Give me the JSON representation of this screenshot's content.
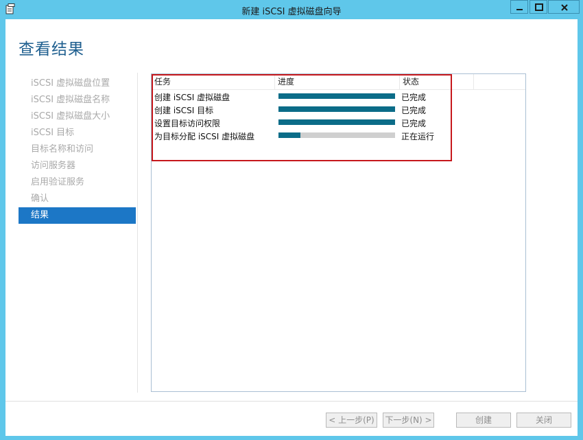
{
  "window": {
    "title": "新建 iSCSI 虚拟磁盘向导"
  },
  "page": {
    "title": "查看结果"
  },
  "sidebar": {
    "steps": [
      {
        "label": "iSCSI 虚拟磁盘位置",
        "active": false
      },
      {
        "label": "iSCSI 虚拟磁盘名称",
        "active": false
      },
      {
        "label": "iSCSI 虚拟磁盘大小",
        "active": false
      },
      {
        "label": "iSCSI 目标",
        "active": false
      },
      {
        "label": "目标名称和访问",
        "active": false
      },
      {
        "label": "访问服务器",
        "active": false
      },
      {
        "label": "启用验证服务",
        "active": false
      },
      {
        "label": "确认",
        "active": false
      },
      {
        "label": "结果",
        "active": true
      }
    ]
  },
  "results": {
    "columns": [
      "任务",
      "进度",
      "状态",
      ""
    ],
    "rows": [
      {
        "task": "创建 iSCSI 虚拟磁盘",
        "progress": 1.0,
        "status": "已完成"
      },
      {
        "task": "创建 iSCSI 目标",
        "progress": 1.0,
        "status": "已完成"
      },
      {
        "task": "设置目标访问权限",
        "progress": 1.0,
        "status": "已完成"
      },
      {
        "task": "为目标分配 iSCSI 虚拟磁盘",
        "progress": 0.19,
        "status": "正在运行"
      }
    ]
  },
  "footer": {
    "prev_label": "< 上一步(P)",
    "next_label": "下一步(N) >",
    "create_label": "创建",
    "cancel_label": "关闭"
  },
  "colors": {
    "title_bar": "#5fc7ea",
    "accent": "#1c77c6",
    "progress": "#0b6c88",
    "highlight_border": "#c6171b",
    "page_title": "#1f5f8f"
  }
}
